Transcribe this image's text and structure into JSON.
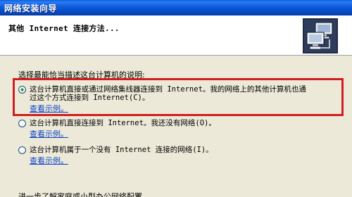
{
  "window": {
    "title": "网络安装向导"
  },
  "header": {
    "title": "其他 Internet 连接方法...",
    "icon": "network-computers-icon"
  },
  "body": {
    "prompt": "选择最能恰当描述这台计算机的说明:",
    "options": [
      {
        "line1": "这台计算机直接或通过网络集线器连接到 Internet。我的网络上的其他计算机也通",
        "line2": "过这个方式连接到 Internet(C)。",
        "link": "查看示例。",
        "selected": true
      },
      {
        "line1": "这台计算机直接连接到 Internet。我还没有网络(O)。",
        "link": "查看示例。",
        "selected": false
      },
      {
        "line1": "这台计算机属于一个没有 Internet 连接的网络(I)。",
        "link": "查看示例。",
        "selected": false
      }
    ],
    "bottom_text": "进一步了解家庭或小型办公网络配置。"
  },
  "colors": {
    "titlebar": "#0a57d6",
    "highlight": "#d01e1e",
    "link": "#0b43c8",
    "radio_dot": "#21a121"
  }
}
